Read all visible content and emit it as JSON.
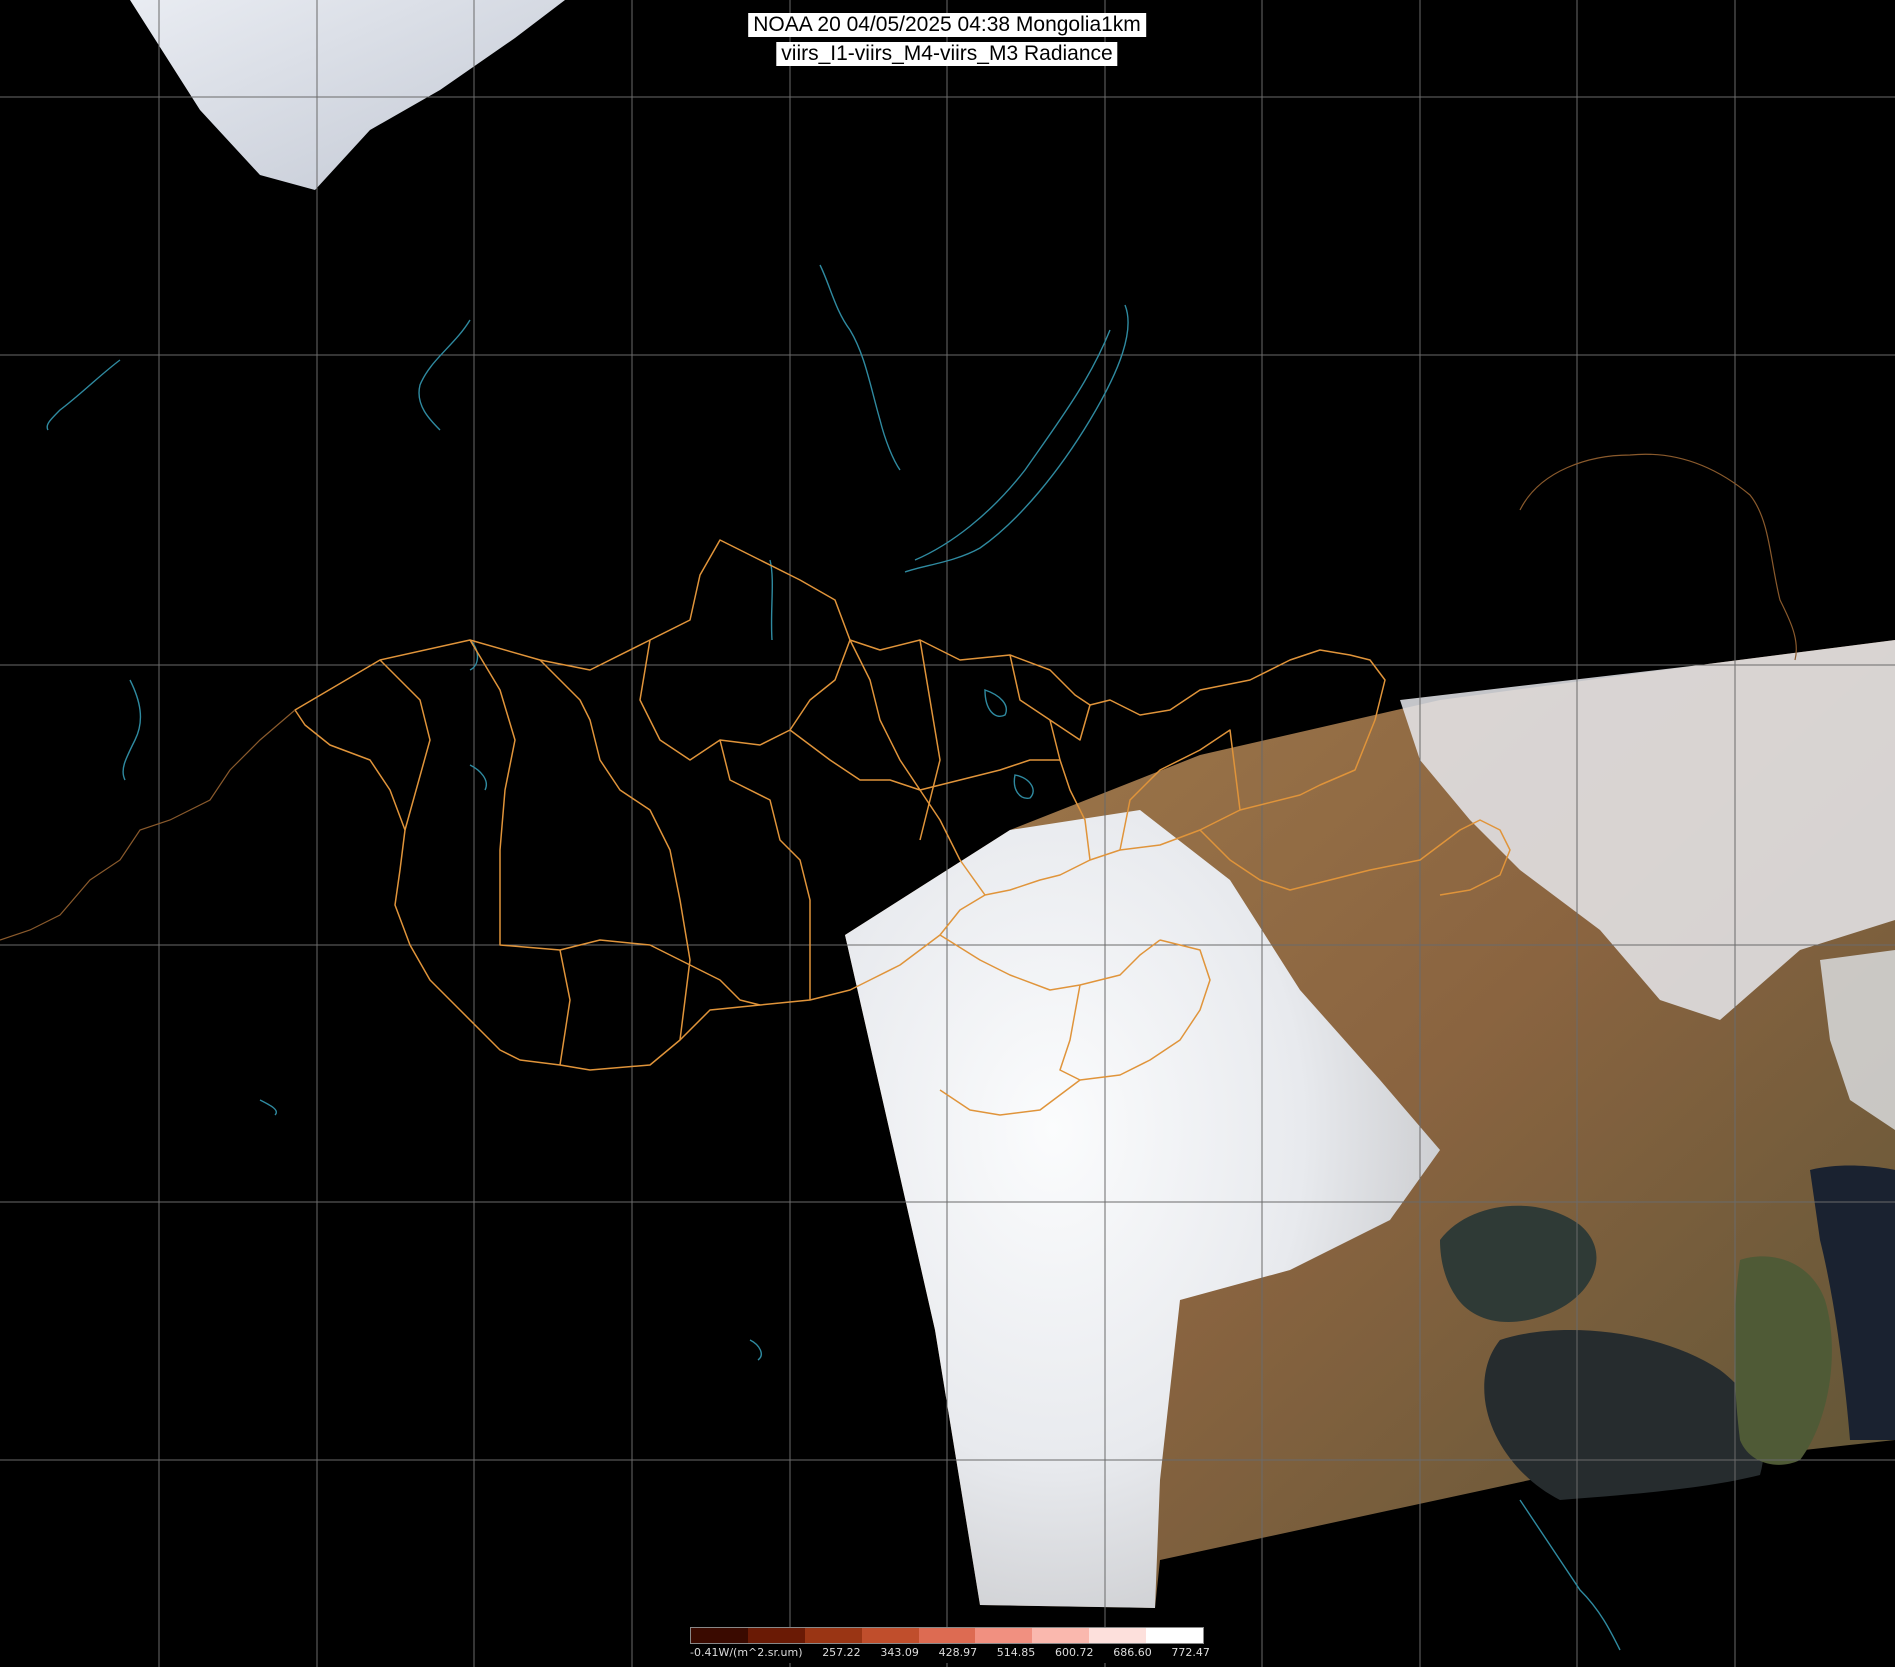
{
  "title": {
    "line1": "NOAA 20 04/05/2025 04:38 Mongolia1km",
    "line2": "viirs_I1-viirs_M4-viirs_M3 Radiance"
  },
  "legend": {
    "labels": [
      "-0.41W/(m^2.sr.um)",
      "257.22",
      "343.09",
      "428.97",
      "514.85",
      "600.72",
      "686.60",
      "772.47"
    ],
    "colors": [
      "#3a0a00",
      "#6a1a05",
      "#9a3514",
      "#c04e2c",
      "#dd6b52",
      "#f19080",
      "#fab8ae",
      "#fde0dc",
      "#ffffff"
    ]
  },
  "colors": {
    "background": "#000000",
    "grid": "#6a6a6a",
    "province_border": "#e0943a",
    "coast_lake": "#2f8aa0",
    "cloud": "#eef0f3",
    "land": "#8a6a46",
    "sea": "#2a3232"
  }
}
